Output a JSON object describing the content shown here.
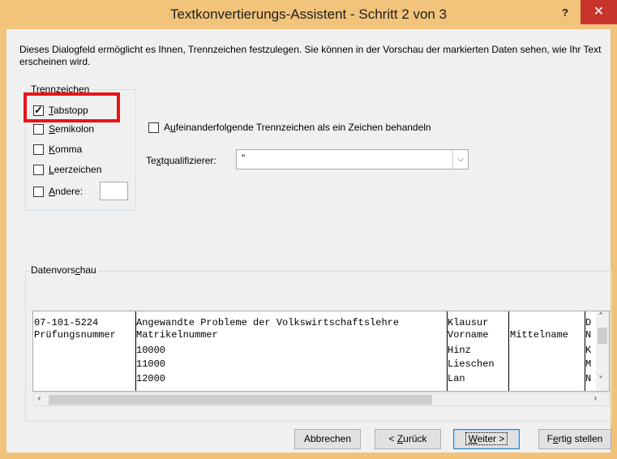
{
  "window": {
    "title": "Textkonvertierungs-Assistent - Schritt 2 von 3",
    "help": "?",
    "close": "✕"
  },
  "description": "Dieses Dialogfeld ermöglicht es Ihnen, Trennzeichen festzulegen. Sie können in der Vorschau der markierten Daten sehen, wie Ihr Text erscheinen wird.",
  "delimiters": {
    "legend": "Trennzeichen",
    "items": [
      {
        "pre": "",
        "u": "T",
        "post": "abstopp",
        "checked": true
      },
      {
        "pre": "",
        "u": "S",
        "post": "emikolon",
        "checked": false
      },
      {
        "pre": "",
        "u": "K",
        "post": "omma",
        "checked": false
      },
      {
        "pre": "",
        "u": "L",
        "post": "eerzeichen",
        "checked": false
      },
      {
        "pre": "",
        "u": "A",
        "post": "ndere:",
        "checked": false
      }
    ],
    "other_value": ""
  },
  "consecutive": {
    "pre": "A",
    "u": "u",
    "post": "feinanderfolgende Trennzeichen als ein Zeichen behandeln",
    "checked": false
  },
  "text_qualifier": {
    "pre": "Te",
    "u": "x",
    "post": "tqualifizierer:",
    "value": "\""
  },
  "preview": {
    "legend_pre": "Datenvors",
    "legend_u": "c",
    "legend_post": "hau",
    "columns": [
      {
        "rows": [
          "07-101-5224",
          "Prüfungsnummer",
          "",
          "",
          ""
        ]
      },
      {
        "rows": [
          "Angewandte Probleme der Volkswirtschaftslehre",
          "Matrikelnummer",
          "10000",
          "11000",
          "12000"
        ]
      },
      {
        "rows": [
          "Klausur",
          "Vorname",
          "Hinz",
          "Lieschen",
          "Lan"
        ]
      },
      {
        "rows": [
          "",
          "Mittelname",
          "",
          "",
          ""
        ]
      },
      {
        "rows": [
          "D",
          "N",
          "K",
          "M",
          "N"
        ]
      }
    ]
  },
  "buttons": {
    "cancel": "Abbrechen",
    "back_pre": "< ",
    "back_u": "Z",
    "back_post": "urück",
    "next_u": "W",
    "next_post": "eiter >",
    "finish_pre": "F",
    "finish_u": "e",
    "finish_post": "rtig stellen"
  }
}
